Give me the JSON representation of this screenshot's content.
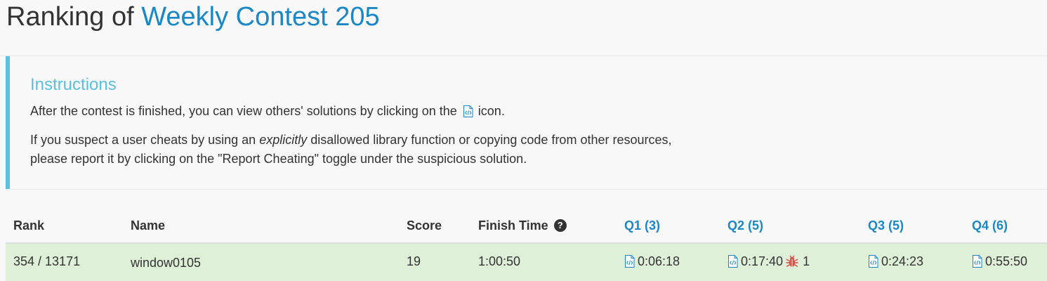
{
  "page": {
    "title_prefix": "Ranking of",
    "contest_name": "Weekly Contest 205"
  },
  "instructions": {
    "heading": "Instructions",
    "line1_before_icon": "After the contest is finished, you can view others' solutions by clicking on the",
    "line1_after_icon": "icon.",
    "line2_before": "If you suspect a user cheats by using an",
    "line2_emphasis": "explicitly",
    "line2_after": "disallowed library function or copying code from other resources,",
    "line3": "please report it by clicking on the \"Report Cheating\" toggle under the suspicious solution."
  },
  "table": {
    "headers": {
      "rank": "Rank",
      "name": "Name",
      "score": "Score",
      "finish_time": "Finish Time",
      "q1": "Q1 (3)",
      "q2": "Q2 (5)",
      "q3": "Q3 (5)",
      "q4": "Q4 (6)"
    },
    "rows": [
      {
        "rank": "354 / 13171",
        "name": "window0105",
        "score": "19",
        "finish_time": "1:00:50",
        "q1": "0:06:18",
        "q2": "0:17:40",
        "q2_penalty": "1",
        "q3": "0:24:23",
        "q4": "0:55:50"
      }
    ]
  },
  "icons": {
    "solution": "code-file-icon",
    "help": "question-circle-icon",
    "penalty": "bug-icon"
  },
  "colors": {
    "link": "#1a87c7",
    "instructions_accent": "#5bc0de",
    "row_success": "#dff0d8",
    "bug": "#d9534f"
  }
}
